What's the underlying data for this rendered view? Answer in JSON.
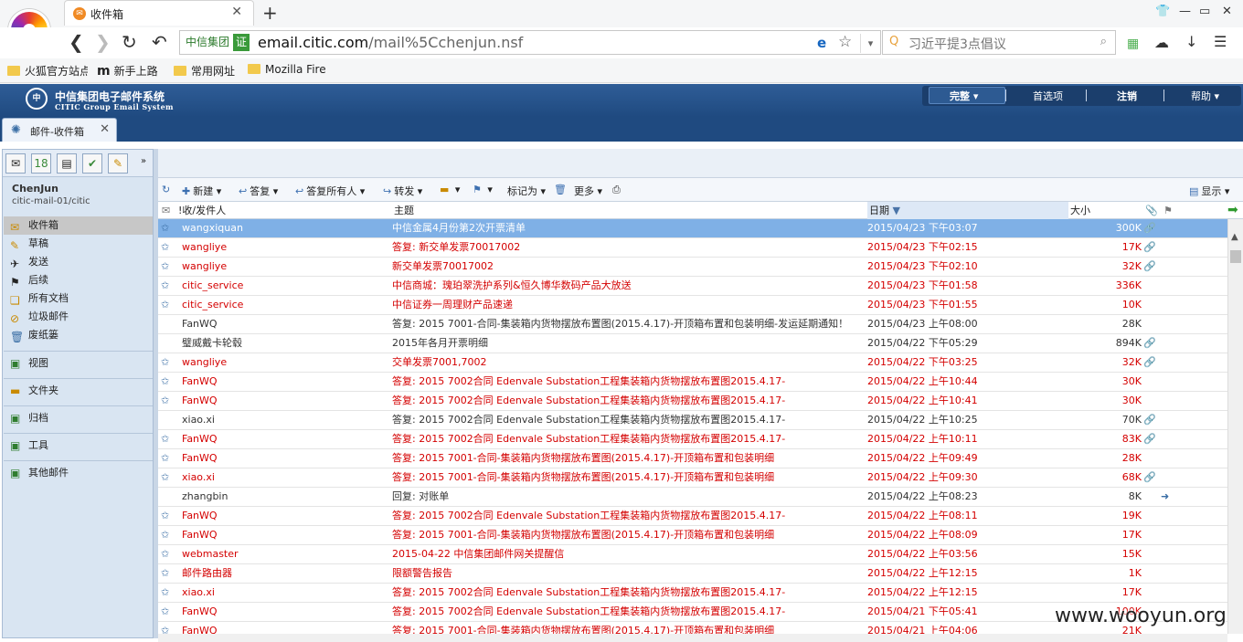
{
  "browser": {
    "tab_title": "收件箱",
    "cert_label": "中信集团",
    "cert_icon": "证",
    "url_host": "email.citic.com",
    "url_path": "/mail%5Cchenjun.nsf",
    "search_placeholder": "习近平提3点倡议",
    "bookmarks": [
      "火狐官方站点",
      "新手上路",
      "常用网址",
      "Mozilla Fire"
    ]
  },
  "app": {
    "brand_cn": "中信集团电子邮件系统",
    "brand_en": "CITIC Group Email System",
    "logo_text": "CITIC",
    "menu": {
      "complete": "完整",
      "prefs": "首选项",
      "logout": "注销",
      "help": "帮助"
    },
    "tab_label": "邮件-收件箱"
  },
  "user": {
    "name": "ChenJun",
    "db": "citic-mail-01/citic"
  },
  "nav": {
    "items": [
      "收件箱",
      "草稿",
      "发送",
      "后续",
      "所有文档",
      "垃圾邮件",
      "废纸篓"
    ],
    "groups": [
      "视图",
      "文件夹",
      "归档",
      "工具",
      "其他邮件"
    ]
  },
  "toolbar": {
    "new": "新建",
    "reply": "答复",
    "reply_all": "答复所有人",
    "forward": "转发",
    "mark_as": "标记为",
    "more": "更多",
    "display": "显示"
  },
  "columns": {
    "from": "!收/发件人",
    "subject": "主题",
    "date": "日期",
    "size": "大小"
  },
  "messages": [
    {
      "from": "wangxiquan",
      "subject": "中信金属4月份第2次开票清单",
      "date": "2015/04/23 下午03:07",
      "size": "300K",
      "att": true,
      "unread": true,
      "selected": true
    },
    {
      "from": "wangliye",
      "subject": "答复: 新交单发票70017002",
      "date": "2015/04/23 下午02:15",
      "size": "17K",
      "att": true,
      "unread": true
    },
    {
      "from": "wangliye",
      "subject": "新交单发票70017002",
      "date": "2015/04/23 下午02:10",
      "size": "32K",
      "att": true,
      "unread": true
    },
    {
      "from": "citic_service",
      "subject": "中信商城：瑰珀翠洗护系列&恒久博华数码产品大放送",
      "date": "2015/04/23 下午01:58",
      "size": "336K",
      "att": false,
      "unread": true
    },
    {
      "from": "citic_service",
      "subject": "中信证券一周理财产品速递",
      "date": "2015/04/23 下午01:55",
      "size": "10K",
      "att": false,
      "unread": true
    },
    {
      "from": "FanWQ",
      "subject": "答复: 2015 7001-合同-集装箱内货物摆放布置图(2015.4.17)-开顶箱布置和包装明细-发运延期通知！",
      "date": "2015/04/23 上午08:00",
      "size": "28K",
      "att": false,
      "unread": false
    },
    {
      "from": "璧威戴卡轮毂",
      "subject": "2015年各月开票明细",
      "date": "2015/04/22 下午05:29",
      "size": "894K",
      "att": true,
      "unread": false
    },
    {
      "from": "wangliye",
      "subject": "交单发票7001,7002",
      "date": "2015/04/22 下午03:25",
      "size": "32K",
      "att": true,
      "unread": true
    },
    {
      "from": "FanWQ",
      "subject": "答复: 2015 7002合同 Edenvale Substation工程集装箱内货物摆放布置图2015.4.17-",
      "date": "2015/04/22 上午10:44",
      "size": "30K",
      "att": false,
      "unread": true
    },
    {
      "from": "FanWQ",
      "subject": "答复: 2015 7002合同 Edenvale Substation工程集装箱内货物摆放布置图2015.4.17-",
      "date": "2015/04/22 上午10:41",
      "size": "30K",
      "att": false,
      "unread": true
    },
    {
      "from": "xiao.xi",
      "subject": "答复: 2015 7002合同 Edenvale Substation工程集装箱内货物摆放布置图2015.4.17-",
      "date": "2015/04/22 上午10:25",
      "size": "70K",
      "att": true,
      "unread": false
    },
    {
      "from": "FanWQ",
      "subject": "答复: 2015 7002合同 Edenvale Substation工程集装箱内货物摆放布置图2015.4.17-",
      "date": "2015/04/22 上午10:11",
      "size": "83K",
      "att": true,
      "unread": true
    },
    {
      "from": "FanWQ",
      "subject": "答复: 2015 7001-合同-集装箱内货物摆放布置图(2015.4.17)-开顶箱布置和包装明细",
      "date": "2015/04/22 上午09:49",
      "size": "28K",
      "att": false,
      "unread": true
    },
    {
      "from": "xiao.xi",
      "subject": "答复: 2015 7001-合同-集装箱内货物摆放布置图(2015.4.17)-开顶箱布置和包装明细",
      "date": "2015/04/22 上午09:30",
      "size": "68K",
      "att": true,
      "unread": true
    },
    {
      "from": "zhangbin",
      "subject": "回复: 对账单",
      "date": "2015/04/22 上午08:23",
      "size": "8K",
      "att": false,
      "flag": true,
      "unread": false
    },
    {
      "from": "FanWQ",
      "subject": "答复: 2015 7002合同 Edenvale Substation工程集装箱内货物摆放布置图2015.4.17-",
      "date": "2015/04/22 上午08:11",
      "size": "19K",
      "att": false,
      "unread": true
    },
    {
      "from": "FanWQ",
      "subject": "答复: 2015 7001-合同-集装箱内货物摆放布置图(2015.4.17)-开顶箱布置和包装明细",
      "date": "2015/04/22 上午08:09",
      "size": "17K",
      "att": false,
      "unread": true
    },
    {
      "from": "webmaster",
      "subject": "2015-04-22 中信集团邮件网关提醒信",
      "date": "2015/04/22 上午03:56",
      "size": "15K",
      "att": false,
      "unread": true
    },
    {
      "from": "邮件路由器",
      "subject": "限额警告报告",
      "date": "2015/04/22 上午12:15",
      "size": "1K",
      "att": false,
      "unread": true
    },
    {
      "from": "xiao.xi",
      "subject": "答复: 2015 7002合同 Edenvale Substation工程集装箱内货物摆放布置图2015.4.17-",
      "date": "2015/04/22 上午12:15",
      "size": "17K",
      "att": false,
      "unread": true
    },
    {
      "from": "FanWQ",
      "subject": "答复: 2015 7002合同 Edenvale Substation工程集装箱内货物摆放布置图2015.4.17-",
      "date": "2015/04/21 下午05:41",
      "size": "100K",
      "att": false,
      "unread": true
    },
    {
      "from": "FanWQ",
      "subject": "答复: 2015 7001-合同-集装箱内货物摆放布置图(2015.4.17)-开顶箱布置和包装明细",
      "date": "2015/04/21 上午04:06",
      "size": "21K",
      "att": false,
      "unread": true
    }
  ],
  "watermark": "www.wooyun.org"
}
